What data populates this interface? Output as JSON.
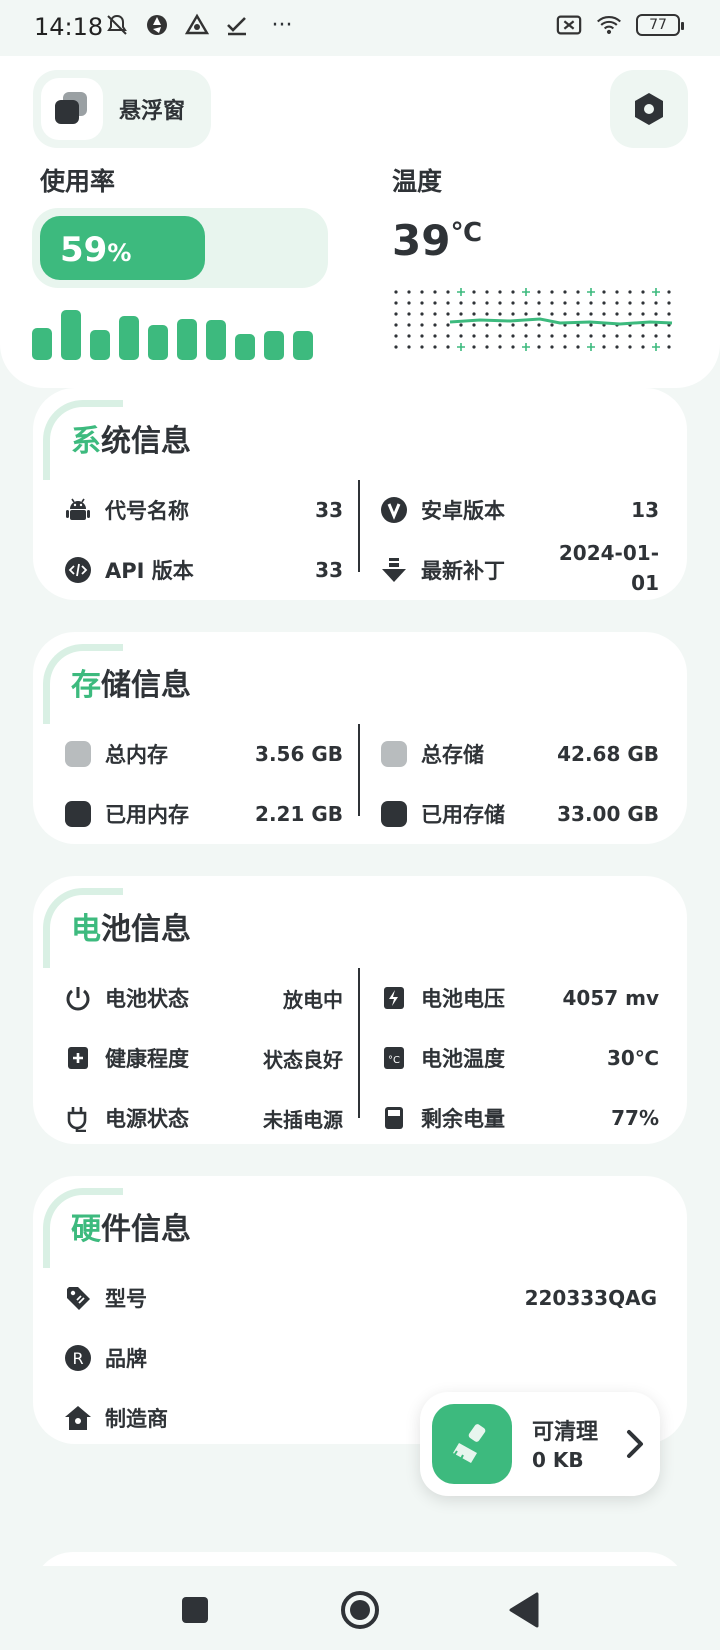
{
  "status_bar": {
    "time": "14:18",
    "more": "···",
    "battery": "77"
  },
  "header": {
    "float_window_label": "悬浮窗"
  },
  "usage": {
    "title": "使用率",
    "percent_value": "59",
    "percent_sign": "%",
    "fill_fraction": 0.59,
    "bars": [
      0.6,
      0.92,
      0.56,
      0.82,
      0.64,
      0.76,
      0.74,
      0.48,
      0.54,
      0.54
    ]
  },
  "temperature": {
    "title": "温度",
    "value": "39",
    "unit": "℃"
  },
  "system_card": {
    "title_first": "系",
    "title_rest": "统信息",
    "left": [
      {
        "label": "代号名称",
        "value": "33",
        "icon": "android-icon"
      },
      {
        "label": "API 版本",
        "value": "33",
        "icon": "api-code-icon"
      }
    ],
    "right": [
      {
        "label": "安卓版本",
        "value": "13",
        "icon": "version-v-icon"
      },
      {
        "label": "最新补丁",
        "value": "2024-01-01",
        "icon": "download-patch-icon"
      }
    ]
  },
  "storage_card": {
    "title_first": "存",
    "title_rest": "储信息",
    "left": [
      {
        "label": "总内存",
        "value": "3.56 GB",
        "icon": "total-memory-swatch"
      },
      {
        "label": "已用内存",
        "value": "2.21 GB",
        "icon": "used-memory-swatch"
      }
    ],
    "right": [
      {
        "label": "总存储",
        "value": "42.68 GB",
        "icon": "total-storage-swatch"
      },
      {
        "label": "已用存储",
        "value": "33.00 GB",
        "icon": "used-storage-swatch"
      }
    ]
  },
  "battery_card": {
    "title_first": "电",
    "title_rest": "池信息",
    "left": [
      {
        "label": "电池状态",
        "value": "放电中",
        "icon": "power-icon"
      },
      {
        "label": "健康程度",
        "value": "状态良好",
        "icon": "health-plus-icon"
      },
      {
        "label": "电源状态",
        "value": "未插电源",
        "icon": "plug-icon"
      }
    ],
    "right": [
      {
        "label": "电池电压",
        "value": "4057 mv",
        "icon": "voltage-icon"
      },
      {
        "label": "电池温度",
        "value": "30℃",
        "icon": "celsius-icon"
      },
      {
        "label": "剩余电量",
        "value": "77%",
        "icon": "battery-level-icon"
      }
    ]
  },
  "hardware_card": {
    "title_first": "硬",
    "title_rest": "件信息",
    "rows": [
      {
        "label": "型号",
        "value": "220333QAG",
        "icon": "tag-icon"
      },
      {
        "label": "品牌",
        "value": "",
        "icon": "registered-icon"
      },
      {
        "label": "制造商",
        "value": "",
        "icon": "home-icon"
      }
    ]
  },
  "cleaner": {
    "label": "可清理",
    "size": "0 KB"
  },
  "colors": {
    "accent": "#3dba7e",
    "dark": "#2f3337",
    "background": "#f2f7f5"
  }
}
